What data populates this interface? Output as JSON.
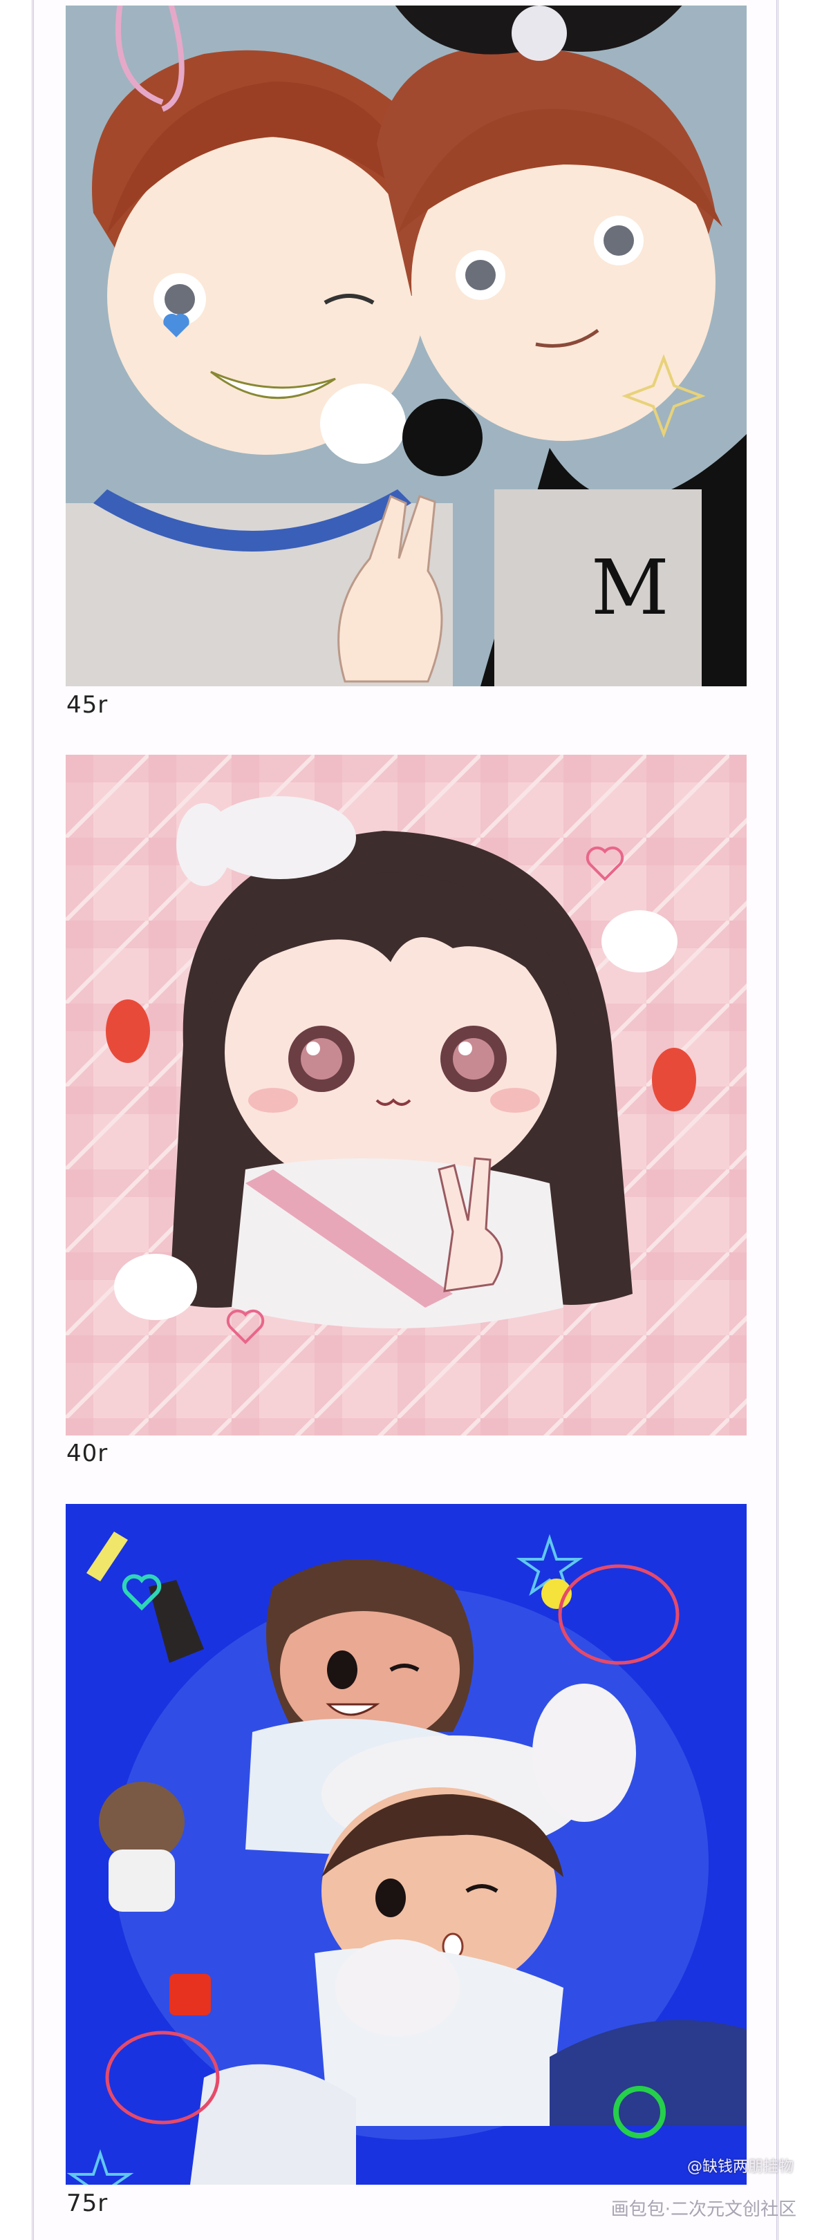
{
  "items": [
    {
      "price": "45r"
    },
    {
      "price": "40r"
    },
    {
      "price": "75r"
    }
  ],
  "watermark": {
    "author": "@缺钱两朋挂物",
    "site": "画包包·二次元文创社区"
  },
  "colors": {
    "card1_bg": "#9fb4c0",
    "card2_bg": "#f3c9cf",
    "card3_bg": "#1a33e0",
    "frame_border": "#cdc6dc"
  }
}
